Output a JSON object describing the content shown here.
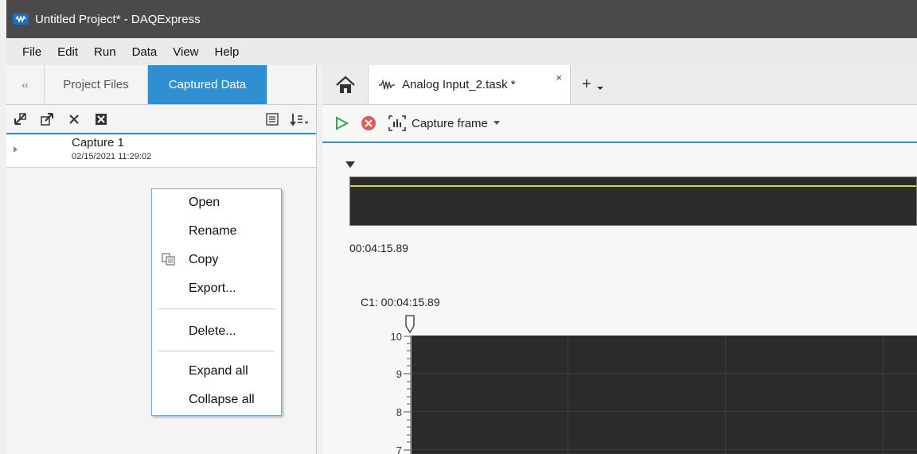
{
  "window": {
    "title": "Untitled Project* - DAQExpress"
  },
  "menubar": {
    "items": [
      "File",
      "Edit",
      "Run",
      "Data",
      "View",
      "Help"
    ]
  },
  "left_panel": {
    "tabs": {
      "collapse": "‹‹",
      "project_files": "Project Files",
      "captured_data": "Captured Data"
    },
    "captures": [
      {
        "name": "Capture 1",
        "date": "02/15/2021 11:29:02"
      }
    ]
  },
  "context_menu": {
    "items": [
      "Open",
      "Rename",
      "Copy",
      "Export...",
      "Delete...",
      "Expand all",
      "Collapse all"
    ]
  },
  "right_panel": {
    "tab_label": "Analog Input_2.task *",
    "close_glyph": "×",
    "add_glyph": "+",
    "capture_frame": "Capture frame",
    "overview_time": "00:04:15.89",
    "cursor_label": "C1: 00:04:15.89",
    "y_ticks": [
      "10",
      "9",
      "8",
      "7"
    ]
  },
  "colors": {
    "accent": "#2f8fd0",
    "title_bar": "#4a4a4a",
    "plot_bg": "#2b2b2b",
    "trace": "#d8d23a"
  }
}
